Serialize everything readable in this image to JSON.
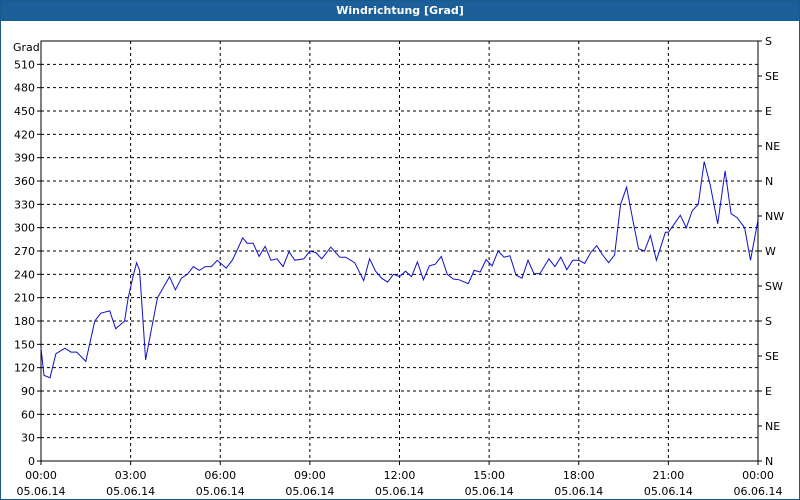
{
  "window": {
    "title": "Windrichtung [Grad]"
  },
  "chart_data": {
    "type": "line",
    "title": "Windrichtung [Grad]",
    "ylabel": "Grad",
    "xlabel": "",
    "ylim": [
      0,
      540
    ],
    "xlim_hours": [
      0,
      24
    ],
    "y_ticks": [
      0,
      30,
      60,
      90,
      120,
      150,
      180,
      210,
      240,
      270,
      300,
      330,
      360,
      390,
      420,
      450,
      480,
      510
    ],
    "y_right_ticks": [
      {
        "value": 0,
        "label": "N"
      },
      {
        "value": 45,
        "label": "NE"
      },
      {
        "value": 90,
        "label": "E"
      },
      {
        "value": 135,
        "label": "SE"
      },
      {
        "value": 180,
        "label": "S"
      },
      {
        "value": 225,
        "label": "SW"
      },
      {
        "value": 270,
        "label": "W"
      },
      {
        "value": 315,
        "label": "NW"
      },
      {
        "value": 360,
        "label": "N"
      },
      {
        "value": 405,
        "label": "NE"
      },
      {
        "value": 450,
        "label": "E"
      },
      {
        "value": 495,
        "label": "SE"
      },
      {
        "value": 540,
        "label": "S"
      }
    ],
    "x_ticks": [
      {
        "hour": 0,
        "time": "00:00",
        "date": "05.06.14"
      },
      {
        "hour": 3,
        "time": "03:00",
        "date": "05.06.14"
      },
      {
        "hour": 6,
        "time": "06:00",
        "date": "05.06.14"
      },
      {
        "hour": 9,
        "time": "09:00",
        "date": "05.06.14"
      },
      {
        "hour": 12,
        "time": "12:00",
        "date": "05.06.14"
      },
      {
        "hour": 15,
        "time": "15:00",
        "date": "05.06.14"
      },
      {
        "hour": 18,
        "time": "18:00",
        "date": "05.06.14"
      },
      {
        "hour": 21,
        "time": "21:00",
        "date": "05.06.14"
      },
      {
        "hour": 24,
        "time": "00:00",
        "date": "06.06.14"
      }
    ],
    "grid": true,
    "line_color": "#1010c8",
    "series": [
      {
        "x_hours": [
          0.0,
          0.1,
          0.3,
          0.5,
          0.8,
          1.0,
          1.2,
          1.5,
          1.8,
          2.0,
          2.3,
          2.5,
          2.8,
          2.92,
          3.1,
          3.2,
          3.3,
          3.5,
          3.7,
          3.9,
          4.05,
          4.3,
          4.5,
          4.7,
          4.9,
          5.1,
          5.3,
          5.5,
          5.7,
          5.9,
          6.2,
          6.4,
          6.55,
          6.75,
          6.9,
          7.1,
          7.3,
          7.5,
          7.7,
          7.9,
          8.1,
          8.3,
          8.5,
          8.8,
          9.0,
          9.2,
          9.4,
          9.7,
          10.0,
          10.2,
          10.5,
          10.8,
          11.0,
          11.2,
          11.4,
          11.6,
          11.8,
          12.0,
          12.2,
          12.4,
          12.6,
          12.8,
          13.0,
          13.2,
          13.4,
          13.6,
          13.8,
          14.0,
          14.3,
          14.5,
          14.7,
          14.9,
          15.1,
          15.3,
          15.5,
          15.7,
          15.9,
          16.1,
          16.3,
          16.5,
          16.7,
          17.0,
          17.2,
          17.4,
          17.6,
          17.8,
          18.0,
          18.2,
          18.4,
          18.6,
          18.8,
          19.0,
          19.2,
          19.4,
          19.6,
          19.8,
          20.0,
          20.2,
          20.4,
          20.6,
          20.9,
          21.0,
          21.2,
          21.4,
          21.6,
          21.8,
          22.0,
          22.2,
          22.4,
          22.65,
          22.9,
          23.1,
          23.3,
          23.55,
          23.75,
          24.0
        ],
        "y": [
          145,
          110,
          107,
          138,
          145,
          140,
          140,
          128,
          180,
          190,
          193,
          170,
          180,
          210,
          240,
          255,
          245,
          130,
          170,
          210,
          220,
          237,
          220,
          235,
          240,
          250,
          245,
          250,
          250,
          258,
          248,
          258,
          270,
          287,
          280,
          280,
          263,
          276,
          258,
          260,
          250,
          269,
          258,
          260,
          270,
          268,
          260,
          275,
          262,
          262,
          255,
          232,
          260,
          244,
          235,
          230,
          240,
          237,
          244,
          237,
          256,
          233,
          251,
          253,
          263,
          240,
          234,
          233,
          228,
          245,
          243,
          259,
          251,
          270,
          262,
          264,
          239,
          235,
          258,
          241,
          241,
          260,
          250,
          262,
          246,
          258,
          258,
          254,
          268,
          277,
          265,
          255,
          265,
          330,
          352,
          312,
          273,
          270,
          290,
          258,
          294,
          294,
          305,
          316,
          300,
          322,
          330,
          385,
          355,
          305,
          373,
          318,
          313,
          300,
          258,
          310
        ]
      }
    ]
  }
}
